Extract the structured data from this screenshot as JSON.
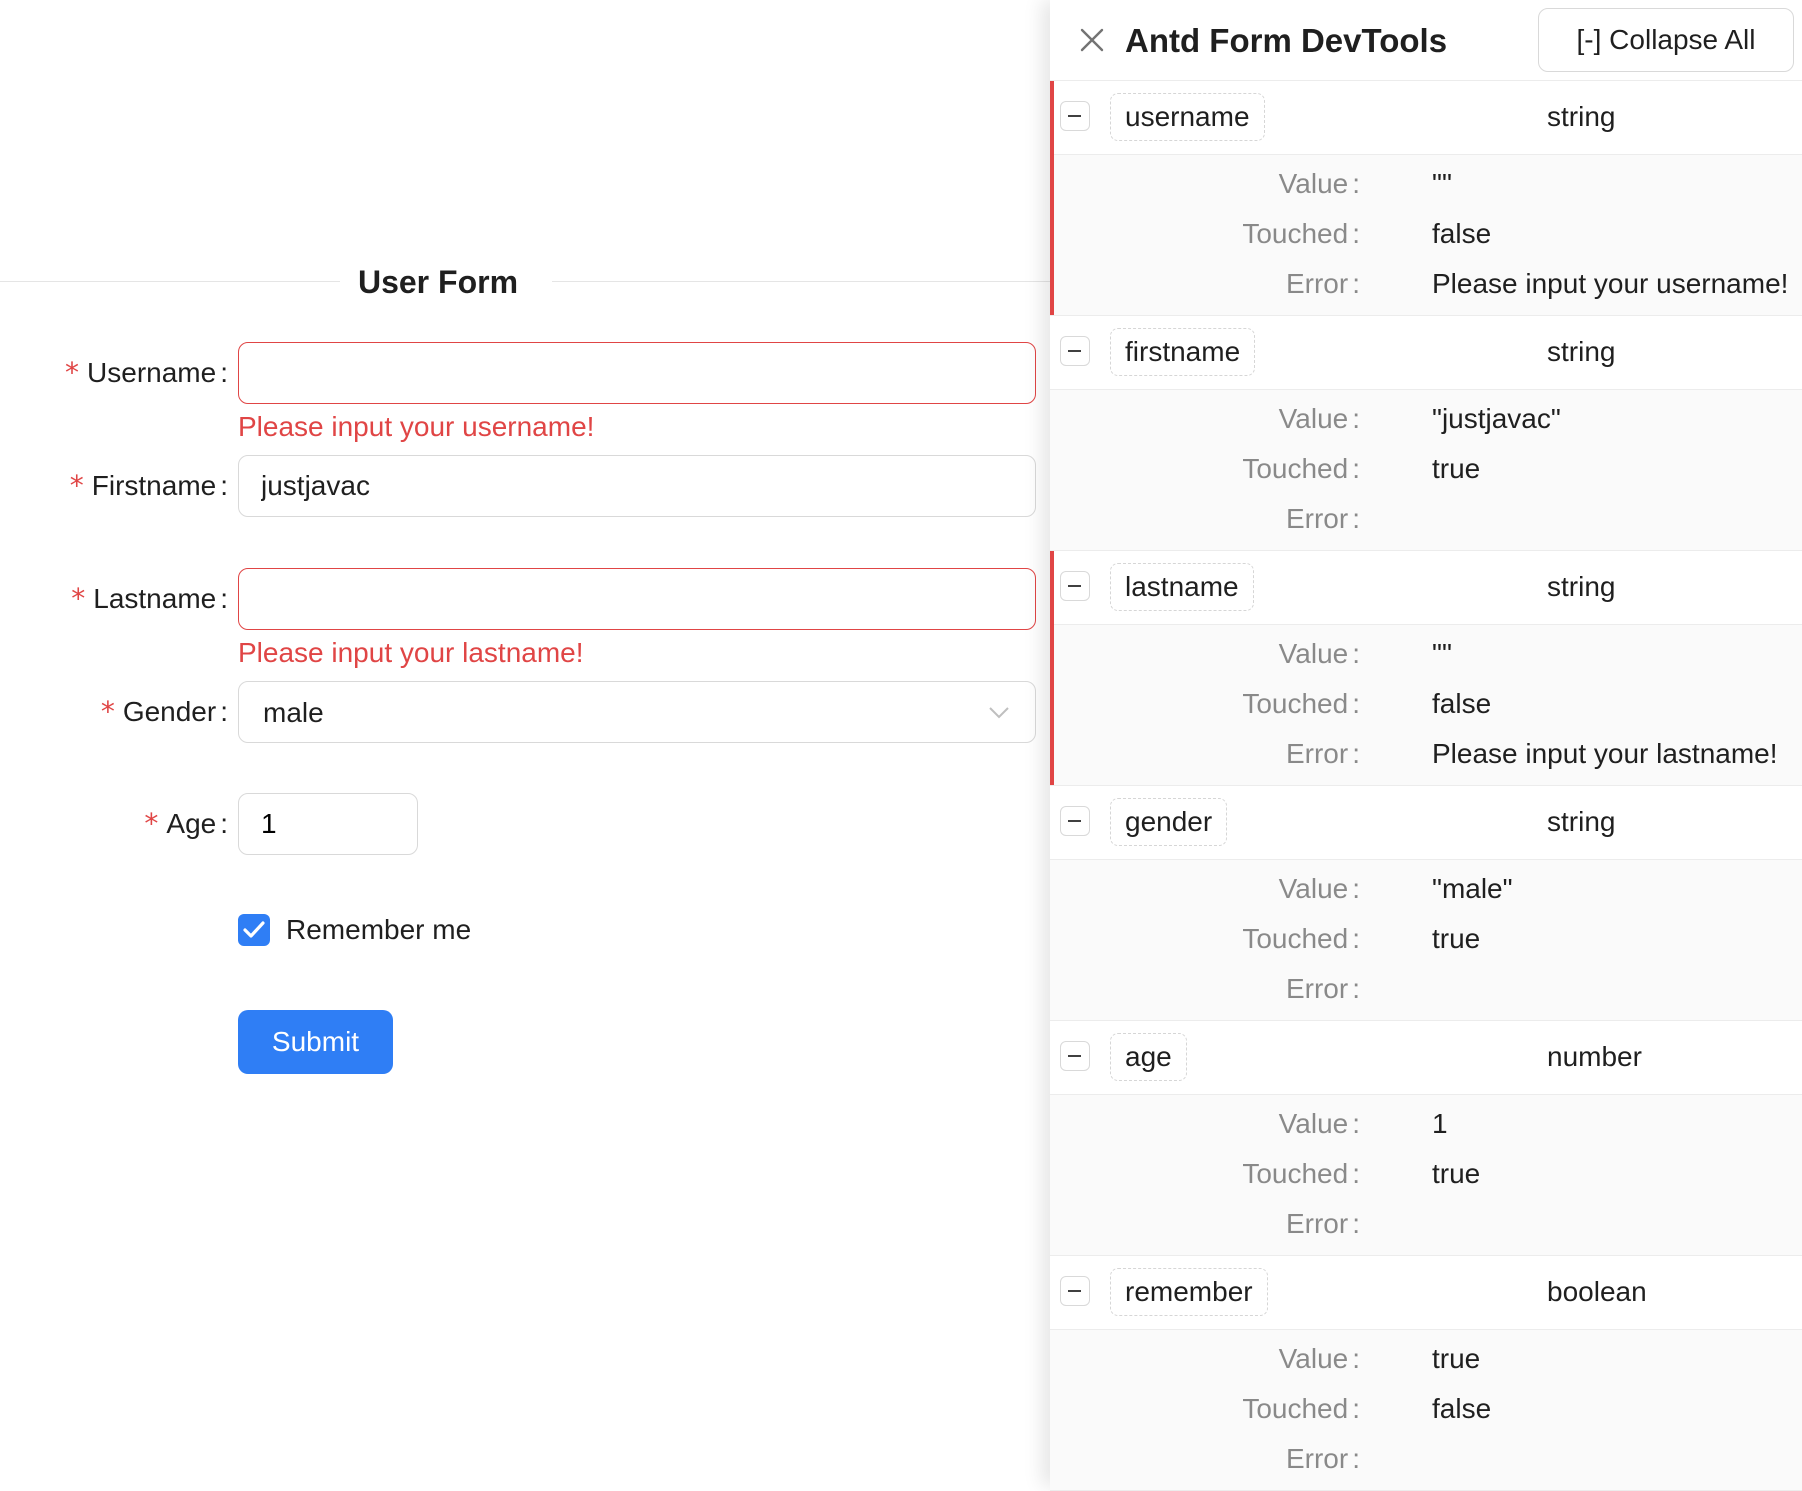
{
  "form": {
    "title": "User Form",
    "colon": ":",
    "required_mark": "*",
    "username": {
      "label": "Username",
      "value": "",
      "error": "Please input your username!"
    },
    "firstname": {
      "label": "Firstname",
      "value": "justjavac"
    },
    "lastname": {
      "label": "Lastname",
      "value": "",
      "error": "Please input your lastname!"
    },
    "gender": {
      "label": "Gender",
      "value": "male",
      "icon": "chevron-down-icon"
    },
    "age": {
      "label": "Age",
      "value": "1"
    },
    "remember": {
      "label": "Remember me",
      "checked": true
    },
    "submit_label": "Submit",
    "colors": {
      "primary": "#2f7ef5",
      "error": "#e04545",
      "border": "#d9d9d9"
    }
  },
  "devtools": {
    "title": "Antd Form DevTools",
    "close_icon": "close-icon",
    "collapse_label": "[-] Collapse All",
    "prop_labels": {
      "value": "Value",
      "touched": "Touched",
      "error": "Error"
    },
    "fields": [
      {
        "name": "username",
        "type": "string",
        "value": "\"\"",
        "touched": "false",
        "error": "Please input your username!"
      },
      {
        "name": "firstname",
        "type": "string",
        "value": "\"justjavac\"",
        "touched": "true",
        "error": ""
      },
      {
        "name": "lastname",
        "type": "string",
        "value": "\"\"",
        "touched": "false",
        "error": "Please input your lastname!"
      },
      {
        "name": "gender",
        "type": "string",
        "value": "\"male\"",
        "touched": "true",
        "error": ""
      },
      {
        "name": "age",
        "type": "number",
        "value": "1",
        "touched": "true",
        "error": ""
      },
      {
        "name": "remember",
        "type": "boolean",
        "value": "true",
        "touched": "false",
        "error": ""
      }
    ]
  }
}
